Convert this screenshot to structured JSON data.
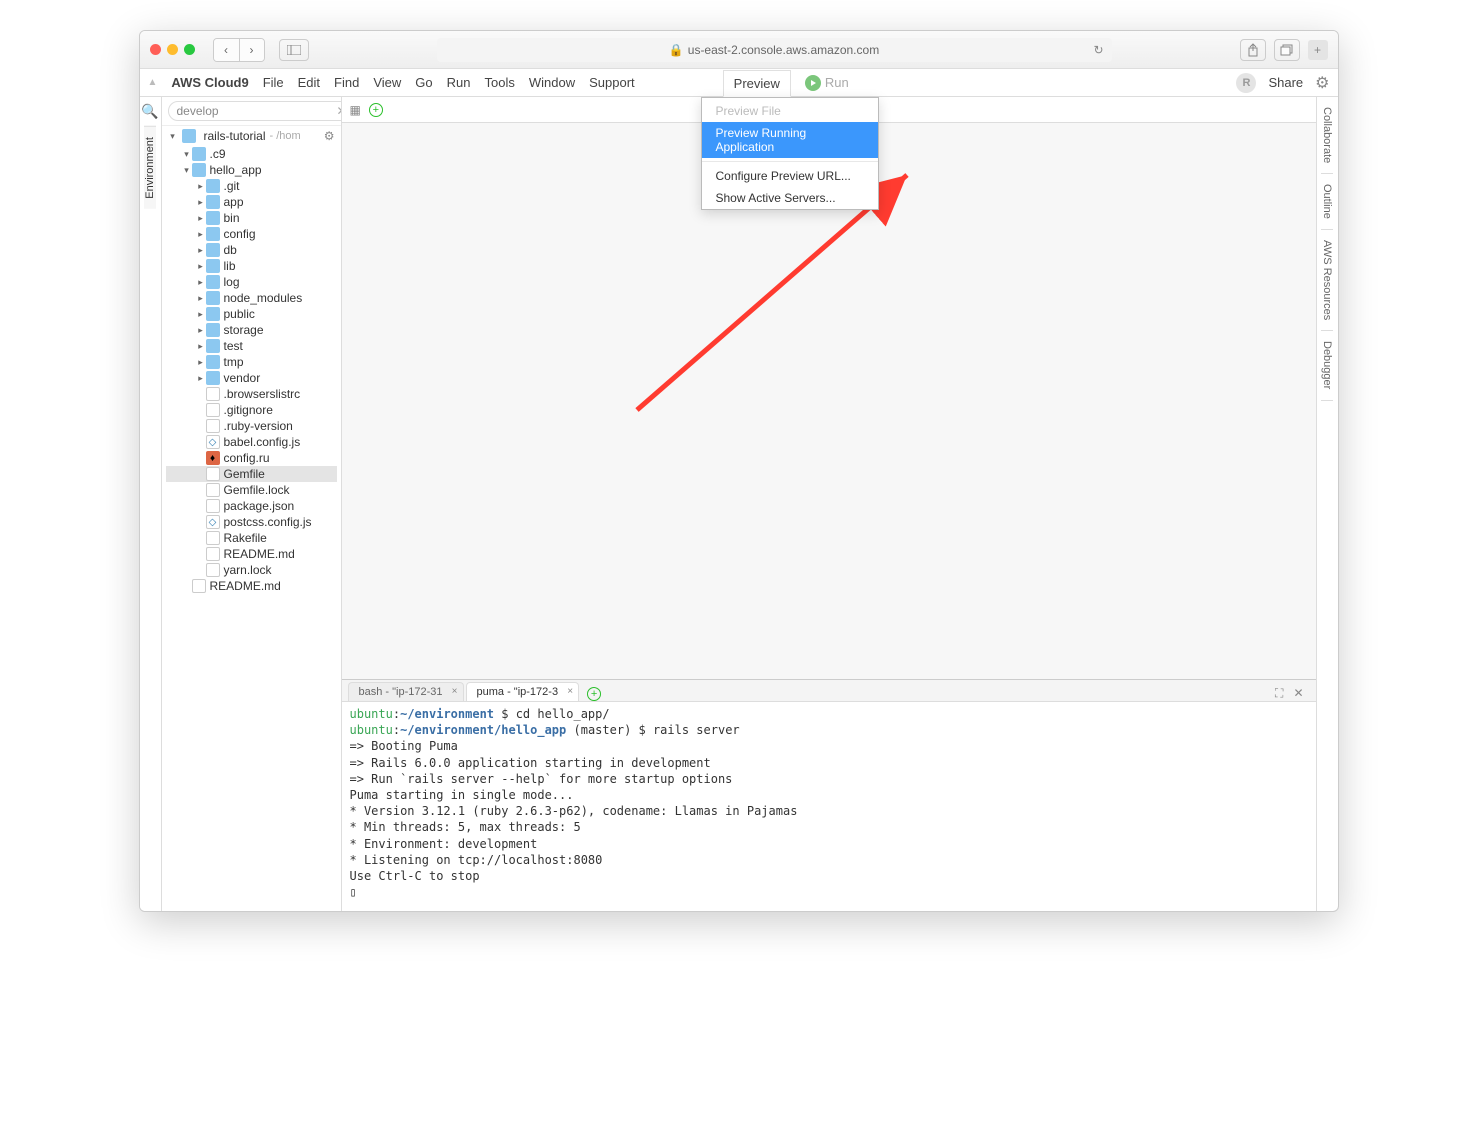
{
  "browser": {
    "url": "us-east-2.console.aws.amazon.com",
    "lock": "🔒"
  },
  "menubar": {
    "brand": "AWS Cloud9",
    "items": [
      "File",
      "Edit",
      "Find",
      "View",
      "Go",
      "Run",
      "Tools",
      "Window",
      "Support"
    ],
    "preview": "Preview",
    "run": "Run",
    "share": "Share",
    "avatar": "R"
  },
  "dropdown": {
    "preview_file": "Preview File",
    "preview_running": "Preview Running Application",
    "configure": "Configure Preview URL...",
    "show_servers": "Show Active Servers..."
  },
  "left_rail": {
    "environment": "Environment"
  },
  "right_rail": {
    "collaborate": "Collaborate",
    "outline": "Outline",
    "aws": "AWS Resources",
    "debugger": "Debugger"
  },
  "sidebar": {
    "search_value": "develop",
    "project": "rails-tutorial",
    "project_path": "- /hom",
    "tree": [
      {
        "d": 1,
        "t": "folder",
        "exp": true,
        "name": ".c9"
      },
      {
        "d": 1,
        "t": "folder",
        "exp": true,
        "name": "hello_app"
      },
      {
        "d": 2,
        "t": "folder",
        "name": ".git"
      },
      {
        "d": 2,
        "t": "folder",
        "name": "app"
      },
      {
        "d": 2,
        "t": "folder",
        "name": "bin"
      },
      {
        "d": 2,
        "t": "folder",
        "name": "config"
      },
      {
        "d": 2,
        "t": "folder",
        "name": "db"
      },
      {
        "d": 2,
        "t": "folder",
        "name": "lib"
      },
      {
        "d": 2,
        "t": "folder",
        "name": "log"
      },
      {
        "d": 2,
        "t": "folder",
        "name": "node_modules"
      },
      {
        "d": 2,
        "t": "folder",
        "name": "public"
      },
      {
        "d": 2,
        "t": "folder",
        "name": "storage"
      },
      {
        "d": 2,
        "t": "folder",
        "name": "test"
      },
      {
        "d": 2,
        "t": "folder",
        "name": "tmp"
      },
      {
        "d": 2,
        "t": "folder",
        "name": "vendor"
      },
      {
        "d": 2,
        "t": "file",
        "name": ".browserslistrc"
      },
      {
        "d": 2,
        "t": "file",
        "name": ".gitignore"
      },
      {
        "d": 2,
        "t": "file",
        "name": ".ruby-version"
      },
      {
        "d": 2,
        "t": "js",
        "name": "babel.config.js"
      },
      {
        "d": 2,
        "t": "ruby",
        "name": "config.ru"
      },
      {
        "d": 2,
        "t": "file",
        "name": "Gemfile",
        "selected": true
      },
      {
        "d": 2,
        "t": "file",
        "name": "Gemfile.lock"
      },
      {
        "d": 2,
        "t": "file",
        "name": "package.json"
      },
      {
        "d": 2,
        "t": "js",
        "name": "postcss.config.js"
      },
      {
        "d": 2,
        "t": "file",
        "name": "Rakefile"
      },
      {
        "d": 2,
        "t": "file",
        "name": "README.md"
      },
      {
        "d": 2,
        "t": "file",
        "name": "yarn.lock"
      },
      {
        "d": 1,
        "t": "file",
        "name": "README.md"
      }
    ]
  },
  "terminal": {
    "tabs": [
      {
        "label": "bash - \"ip-172-31",
        "active": false
      },
      {
        "label": "puma - \"ip-172-3",
        "active": true
      }
    ],
    "lines": [
      {
        "seg": [
          {
            "c": "tg",
            "s": "ubuntu"
          },
          {
            "c": "tn",
            "s": ":"
          },
          {
            "c": "tb",
            "s": "~/environment"
          },
          {
            "c": "tn",
            "s": " $ cd hello_app/"
          }
        ]
      },
      {
        "seg": [
          {
            "c": "tg",
            "s": "ubuntu"
          },
          {
            "c": "tn",
            "s": ":"
          },
          {
            "c": "tb",
            "s": "~/environment/hello_app"
          },
          {
            "c": "tn",
            "s": " (master) $ rails server"
          }
        ]
      },
      {
        "seg": [
          {
            "c": "tn",
            "s": "=> Booting Puma"
          }
        ]
      },
      {
        "seg": [
          {
            "c": "tn",
            "s": "=> Rails 6.0.0 application starting in development"
          }
        ]
      },
      {
        "seg": [
          {
            "c": "tn",
            "s": "=> Run `rails server --help` for more startup options"
          }
        ]
      },
      {
        "seg": [
          {
            "c": "tn",
            "s": "Puma starting in single mode..."
          }
        ]
      },
      {
        "seg": [
          {
            "c": "tn",
            "s": "* Version 3.12.1 (ruby 2.6.3-p62), codename: Llamas in Pajamas"
          }
        ]
      },
      {
        "seg": [
          {
            "c": "tn",
            "s": "* Min threads: 5, max threads: 5"
          }
        ]
      },
      {
        "seg": [
          {
            "c": "tn",
            "s": "* Environment: development"
          }
        ]
      },
      {
        "seg": [
          {
            "c": "tn",
            "s": "* Listening on tcp://localhost:8080"
          }
        ]
      },
      {
        "seg": [
          {
            "c": "tn",
            "s": "Use Ctrl-C to stop"
          }
        ]
      },
      {
        "seg": [
          {
            "c": "tn",
            "s": "▯"
          }
        ]
      }
    ]
  }
}
